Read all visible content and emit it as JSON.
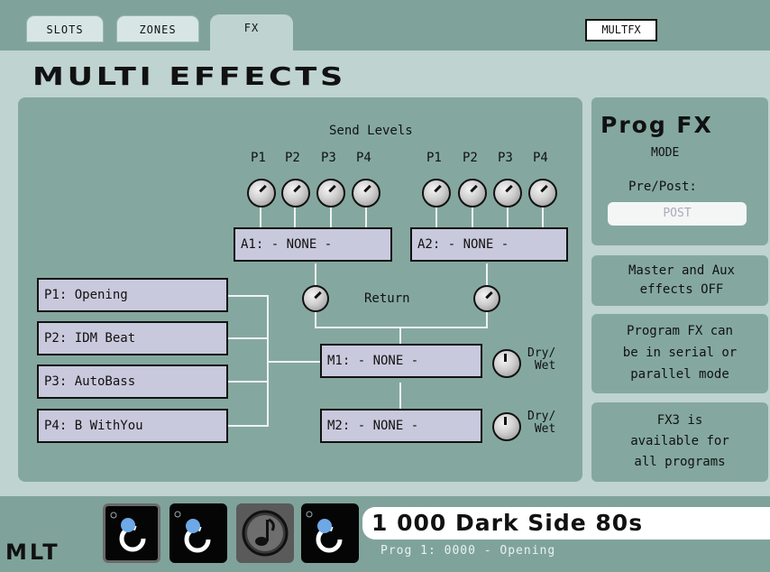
{
  "tabs": {
    "slots": "SLOTS",
    "zones": "ZONES",
    "fx": "FX"
  },
  "mode_indicator": "MULTFX",
  "page_title": "MULTI EFFECTS",
  "send_levels": {
    "title": "Send Levels",
    "group_a1": [
      "P1",
      "P2",
      "P3",
      "P4"
    ],
    "group_a2": [
      "P1",
      "P2",
      "P3",
      "P4"
    ]
  },
  "aux": {
    "a1": "A1: - NONE -",
    "a2": "A2: - NONE -"
  },
  "return_label": "Return",
  "slots": [
    "P1: Opening",
    "P2: IDM Beat",
    "P3: AutoBass",
    "P4: B WithYou"
  ],
  "master": {
    "m1": "M1: - NONE -",
    "m2": "M2: - NONE -",
    "drywet_1a": "Dry/",
    "drywet_1b": "Wet",
    "drywet_2a": "Dry/",
    "drywet_2b": "Wet"
  },
  "prog_fx": {
    "title": "Prog FX",
    "subtitle": "MODE",
    "prepost_label": "Pre/Post:",
    "prepost_value": "POST"
  },
  "info": {
    "master_aux": [
      "Master and Aux",
      "effects OFF"
    ],
    "serial": [
      "Program FX can",
      "be in serial or",
      "parallel mode"
    ],
    "fx3": [
      "FX3 is",
      "available for",
      "all programs"
    ]
  },
  "footer": {
    "mode": "MLT",
    "program_name": "1 000 Dark Side 80s",
    "program_sub": "Prog 1: 0000 - Opening"
  },
  "colors": {
    "panel": "#bfd3d1",
    "fxarea": "#84a89f",
    "slot": "#c9c9dd",
    "background": "#7fa39a"
  }
}
